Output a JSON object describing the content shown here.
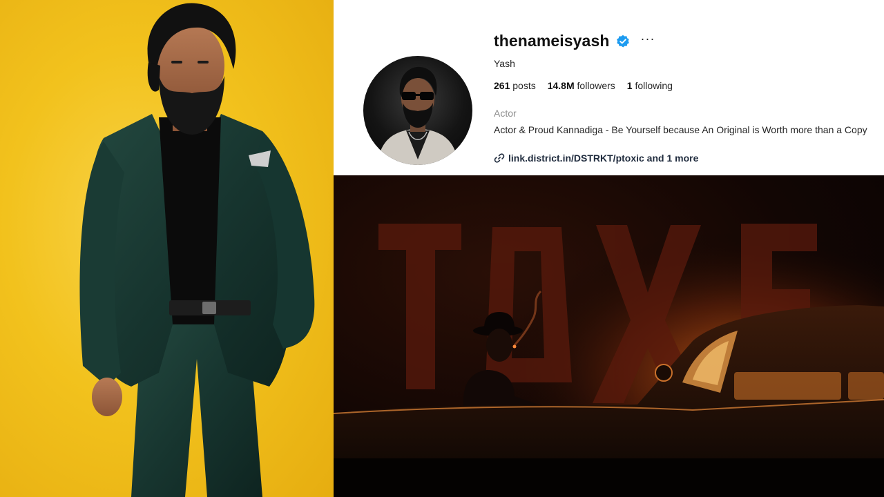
{
  "profile": {
    "username": "thenameisyash",
    "more_label": "···",
    "full_name": "Yash",
    "stats": {
      "posts_count": "261",
      "posts_label": "posts",
      "followers_count": "14.8M",
      "followers_label": "followers",
      "following_count": "1",
      "following_label": "following"
    },
    "category": "Actor",
    "bio": "Actor & Proud Kannadiga - Be Yourself because An Original is Worth more than a Copy",
    "link": "link.district.in/DSTRKT/ptoxic and 1 more"
  },
  "icons": {
    "verified": "verified-badge-icon",
    "more": "more-options-icon",
    "link": "link-chain-icon"
  },
  "colors": {
    "left_background": "#f2c21d",
    "verified_blue": "#1d9bf0",
    "poster_glow": "#e06a1a",
    "header_background": "#ffffff"
  }
}
